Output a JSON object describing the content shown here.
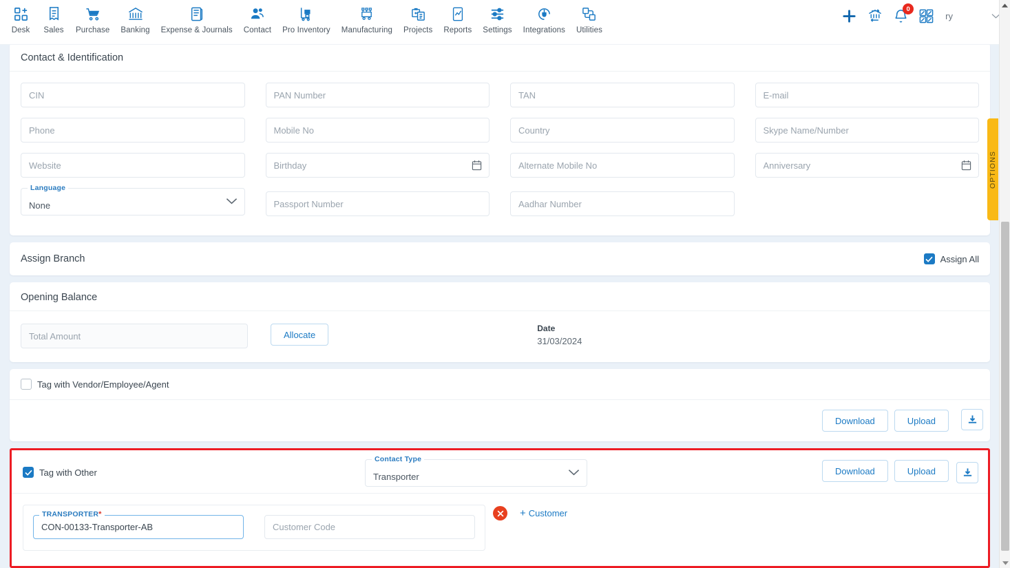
{
  "topnav": {
    "items": [
      {
        "label": "Desk",
        "icon": "desk-grid-plus-icon"
      },
      {
        "label": "Sales",
        "icon": "sales-receipt-icon"
      },
      {
        "label": "Purchase",
        "icon": "purchase-cart-icon"
      },
      {
        "label": "Banking",
        "icon": "banking-bank-icon"
      },
      {
        "label": "Expense & Journals",
        "icon": "expense-journal-book-icon"
      },
      {
        "label": "Contact",
        "icon": "contact-people-icon"
      },
      {
        "label": "Pro Inventory",
        "icon": "pro-inventory-trolley-icon"
      },
      {
        "label": "Manufacturing",
        "icon": "manufacturing-machine-icon"
      },
      {
        "label": "Projects",
        "icon": "projects-clipboard-icon"
      },
      {
        "label": "Reports",
        "icon": "reports-chart-document-icon"
      },
      {
        "label": "Settings",
        "icon": "settings-sliders-icon"
      },
      {
        "label": "Integrations",
        "icon": "integrations-plug-icon"
      },
      {
        "label": "Utilities",
        "icon": "utilities-tools-icon"
      }
    ],
    "right": {
      "add_icon": "plus-icon",
      "switch_company_icon": "switch-bank-icon",
      "notifications_icon": "bell-icon",
      "notifications_count": "0",
      "apps_icon": "apps-grid-icon",
      "user_initials": "ry",
      "caret_icon": "chevron-down-icon"
    }
  },
  "contact_identification": {
    "title": "Contact & Identification",
    "fields": [
      {
        "name": "cin",
        "placeholder": "CIN",
        "value": ""
      },
      {
        "name": "pan-number",
        "placeholder": "PAN Number",
        "value": ""
      },
      {
        "name": "tan",
        "placeholder": "TAN",
        "value": ""
      },
      {
        "name": "email",
        "placeholder": "E-mail",
        "value": ""
      },
      {
        "name": "phone",
        "placeholder": "Phone",
        "value": ""
      },
      {
        "name": "mobile-no",
        "placeholder": "Mobile No",
        "value": ""
      },
      {
        "name": "country",
        "placeholder": "Country",
        "value": ""
      },
      {
        "name": "skype",
        "placeholder": "Skype Name/Number",
        "value": ""
      },
      {
        "name": "website",
        "placeholder": "Website",
        "value": ""
      },
      {
        "name": "birthday",
        "placeholder": "Birthday",
        "value": "",
        "icon": "calendar-icon"
      },
      {
        "name": "alternate-mobile-no",
        "placeholder": "Alternate Mobile No",
        "value": ""
      },
      {
        "name": "anniversary",
        "placeholder": "Anniversary",
        "value": "",
        "icon": "calendar-icon"
      },
      {
        "name": "passport-number",
        "placeholder": "Passport Number",
        "value": ""
      },
      {
        "name": "aadhar-number",
        "placeholder": "Aadhar Number",
        "value": ""
      }
    ],
    "language": {
      "label": "Language",
      "value": "None"
    }
  },
  "assign_branch": {
    "title": "Assign Branch",
    "assign_all_label": "Assign All",
    "assign_all_checked": true
  },
  "opening_balance": {
    "title": "Opening Balance",
    "total_amount_placeholder": "Total Amount",
    "total_amount_value": "",
    "allocate_label": "Allocate",
    "date_label": "Date",
    "date_value": "31/03/2024"
  },
  "tag_vendor": {
    "label": "Tag with Vendor/Employee/Agent",
    "checked": false,
    "download_label": "Download",
    "upload_label": "Upload",
    "tray_icon": "download-tray-icon"
  },
  "tag_other": {
    "label": "Tag with Other",
    "checked": true,
    "contact_type_label": "Contact Type",
    "contact_type_value": "Transporter",
    "download_label": "Download",
    "upload_label": "Upload",
    "tray_icon": "download-tray-icon",
    "transporter_label": "TRANSPORTER",
    "transporter_required": "*",
    "transporter_value": "CON-00133-Transporter-AB",
    "customer_code_placeholder": "Customer Code",
    "customer_code_value": "",
    "remove_icon": "remove-circle-x-icon",
    "add_customer_label": "Customer",
    "add_customer_plus": "+",
    "highlight_color": "#ed1c24"
  },
  "options_tab": {
    "label": "OPTIONS",
    "color": "#f9b916"
  },
  "colors": {
    "accent": "#1b7ac4",
    "page_bg": "#eaf1f8",
    "card_bg": "#ffffff",
    "label_blue": "#2b7cc0",
    "required_red": "#d9372b",
    "remove_red": "#e8401f",
    "badge_red": "#e8291e"
  }
}
